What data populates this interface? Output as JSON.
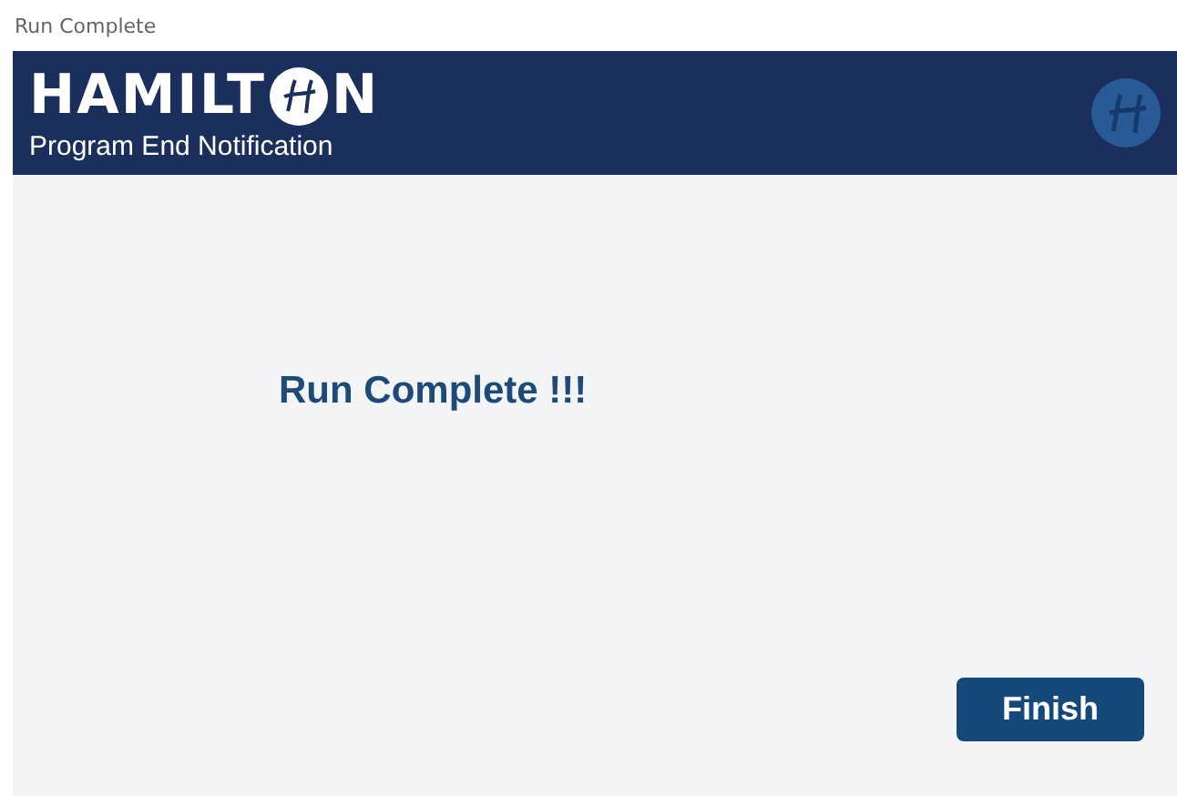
{
  "window": {
    "title": "Run Complete"
  },
  "header": {
    "logo_start": "HAMILT",
    "logo_end": "N",
    "subtitle": "Program End Notification"
  },
  "message": "Run Complete !!!",
  "buttons": [
    {
      "label": "Finish"
    }
  ]
}
